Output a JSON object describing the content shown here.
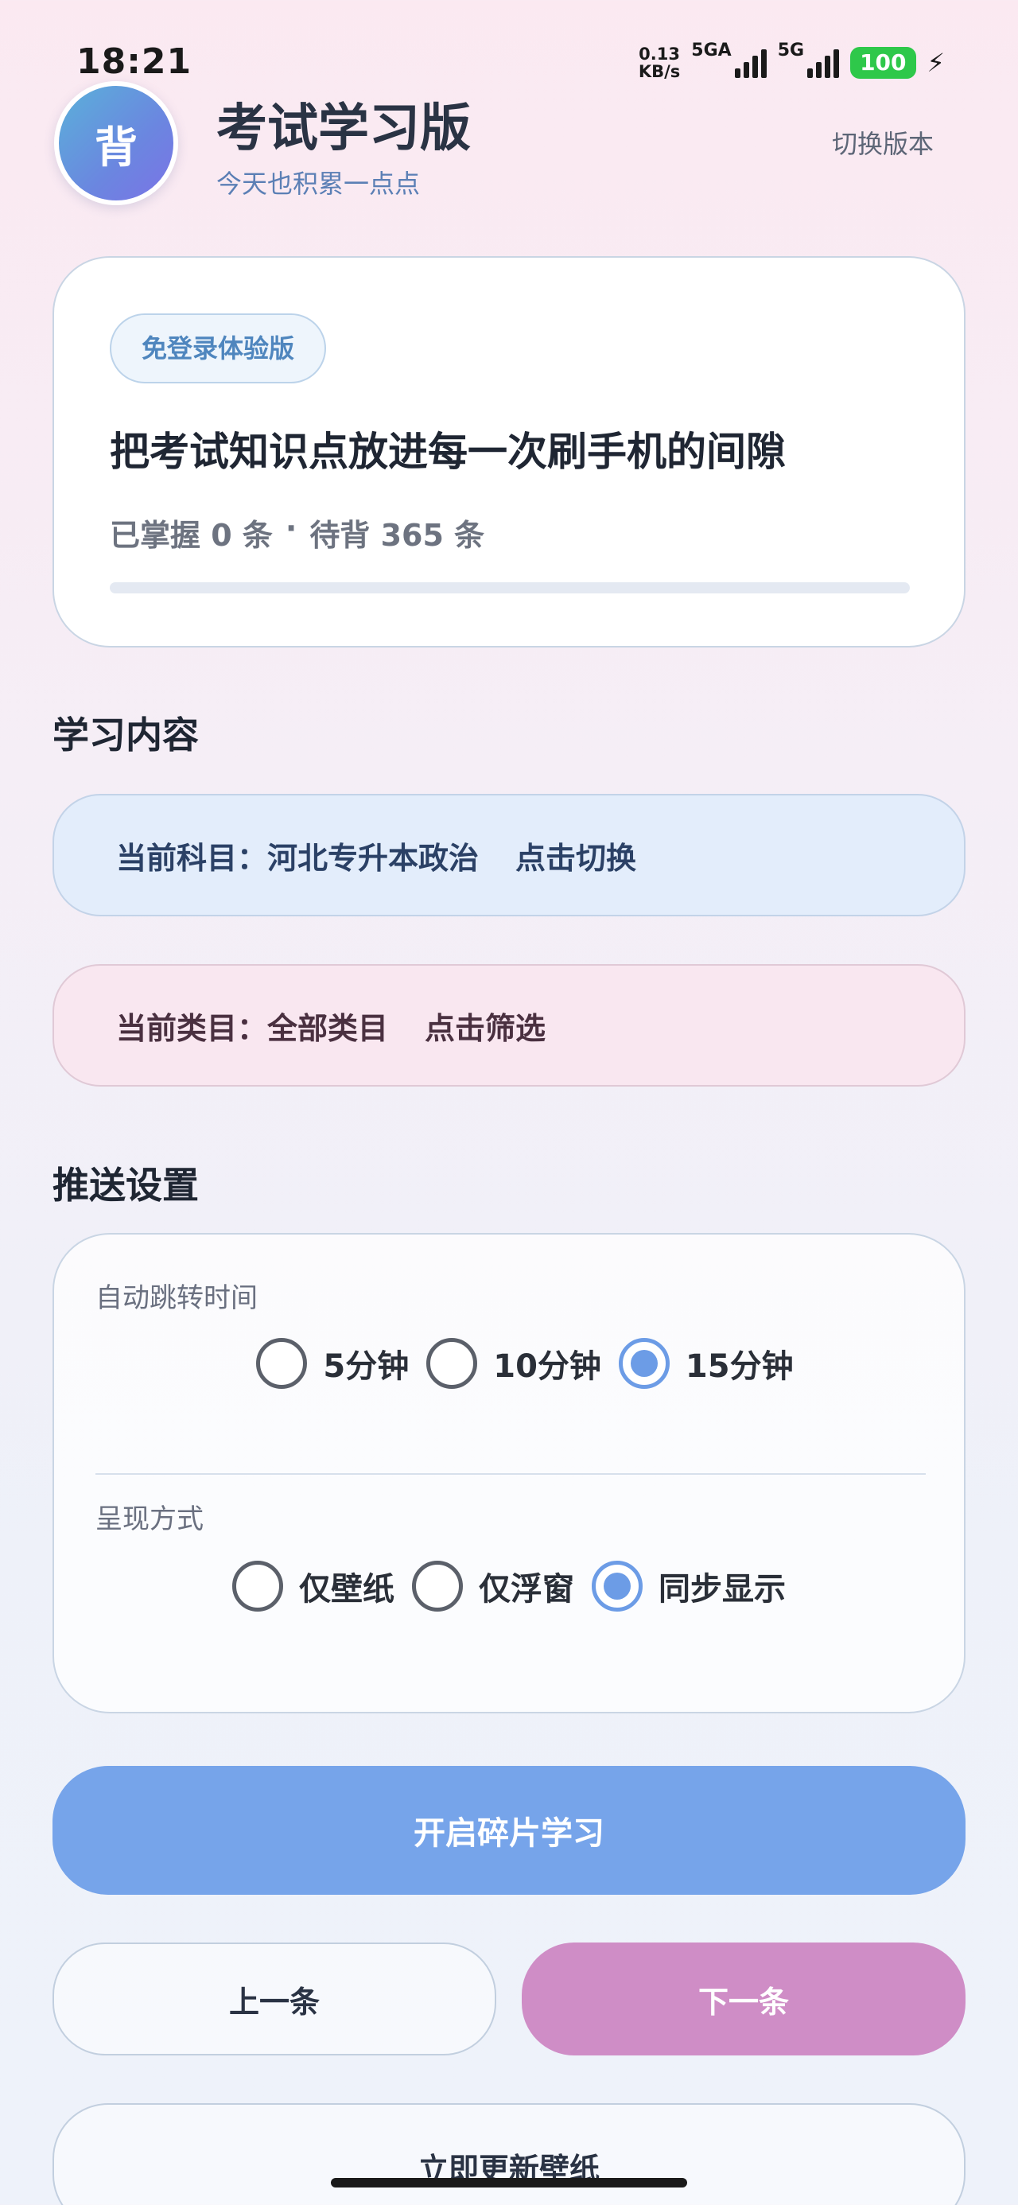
{
  "status_bar": {
    "time": "18:21",
    "speed_value": "0.13",
    "speed_unit": "KB/s",
    "sim1_label": "5GA",
    "sim2_label": "5G",
    "battery": "100",
    "bolt_icon": "charging-bolt-icon"
  },
  "header": {
    "avatar_text": "背",
    "title": "考试学习版",
    "subtitle": "今天也积累一点点",
    "switch_label": "切换版本"
  },
  "hero": {
    "badge": "免登录体验版",
    "headline": "把考试知识点放进每一次刷手机的间隙",
    "mastered": "已掌握 0 条",
    "separator": "·",
    "pending": "待背 365 条",
    "progress_fraction": 0
  },
  "content_section": {
    "title": "学习内容",
    "subject_label": "当前科目：河北专升本政治",
    "subject_action": "点击切换",
    "category_label": "当前类目：全部类目",
    "category_action": "点击筛选"
  },
  "push_section": {
    "title": "推送设置",
    "auto_jump_label": "自动跳转时间",
    "auto_jump_options": [
      "5分钟",
      "10分钟",
      "15分钟"
    ],
    "auto_jump_selected": "15分钟",
    "display_label": "呈现方式",
    "display_options": [
      "仅壁纸",
      "仅浮窗",
      "同步显示"
    ],
    "display_selected": "同步显示"
  },
  "actions": {
    "start": "开启碎片学习",
    "prev": "上一条",
    "next": "下一条",
    "update_wallpaper": "立即更新壁纸"
  },
  "colors": {
    "accent_blue": "#76a4ea",
    "accent_pink": "#cf8dc6",
    "battery_green": "#2ec84a"
  }
}
